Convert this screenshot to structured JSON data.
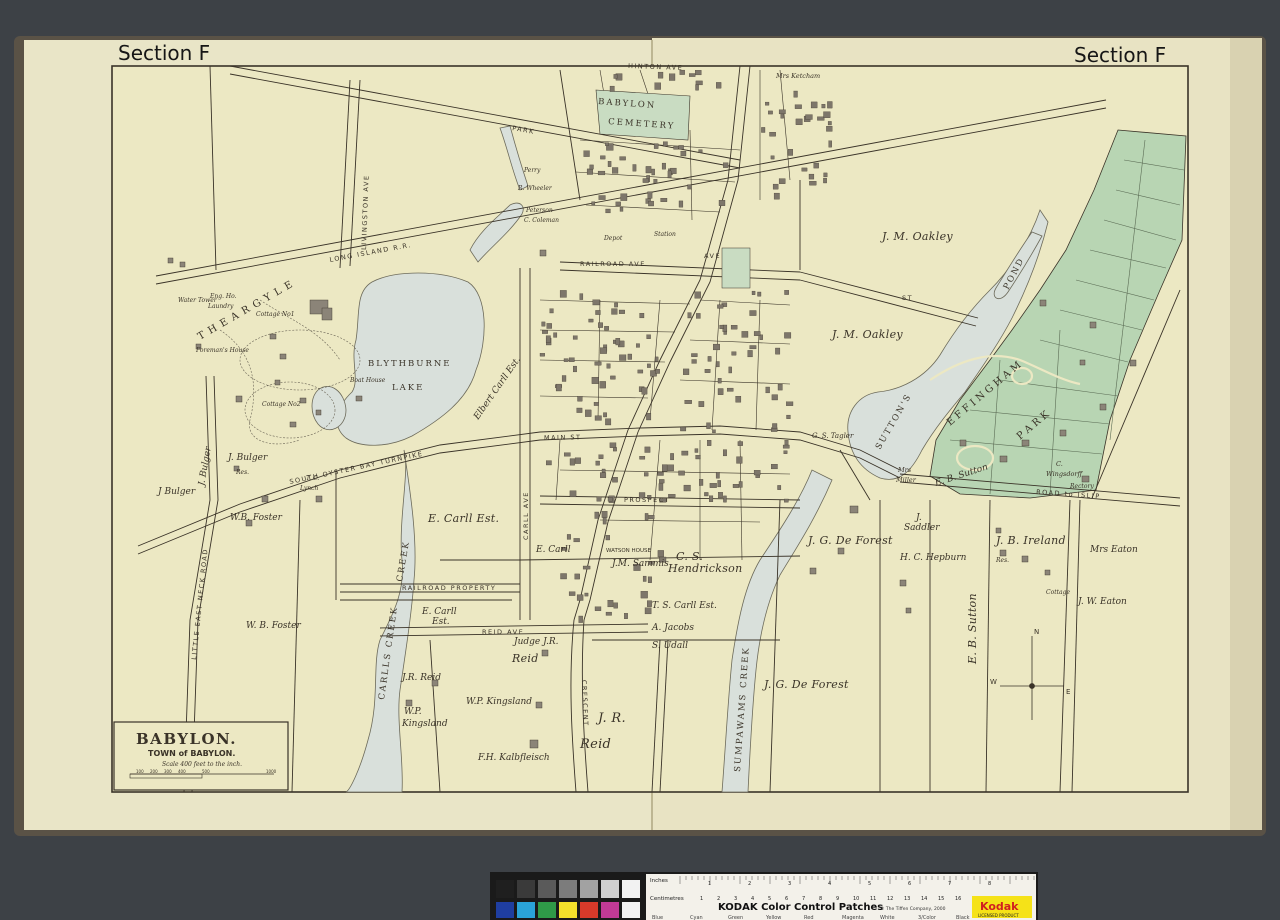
{
  "sheet": {
    "section_left": "Section F",
    "section_right": "Section F"
  },
  "title_box": {
    "title": "BABYLON.",
    "subtitle": "TOWN of BABYLON.",
    "scale": "Scale 400 feet to the inch.",
    "scale_ticks": [
      "100",
      "200",
      "300",
      "400",
      "500",
      "1000"
    ]
  },
  "compass": {
    "n": "N",
    "s": "S",
    "e": "E",
    "w": "W"
  },
  "labels": {
    "section_f": "Section F",
    "the_argyle": "T H E   A R G Y L E",
    "blythburne": "BLYTHBURNE",
    "lake": "LAKE",
    "babylon": "BABYLON",
    "cemetery": "CEMETERY",
    "long_island_rr": "LONG  ISLAND  R.R.",
    "livingston_ave": "LIVINGSTON   AVE",
    "park": "PARK",
    "ave": "AVE",
    "railroad_ave": "RAILROAD   AVE",
    "main_st": "MAIN   ST",
    "south_oyster_bay": "SOUTH  OYSTER  BAY  TURNPIKE",
    "prospect": "PROSPECT",
    "railroad_property": "RAILROAD  PROPERTY",
    "reid_ave": "REID  AVE",
    "carll_ave": "CARLL  AVE",
    "crescent": "CRESCENT",
    "carlls_creek": "CARLLS   CREEK",
    "creek": "CREEK",
    "sumpawams_creek": "SUMPAWAMS  CREEK",
    "suttons_pond": "SUTTON'S",
    "pond": "POND",
    "effingham": "E F F I N G H A M",
    "park_lbl": "P A R K",
    "road_to_islip": "ROAD  to  ISLIP",
    "little_east_neck_road": "LITTLE  EAST  NECK  ROAD",
    "hinton_ave": "HINTON  AVE",
    "st": "ST",
    "jm_oakley_1": "J. M. Oakley",
    "jm_oakley_2": "J. M. Oakley",
    "e_carll_est": "E. Carll  Est.",
    "e_carll_est_2": "E. Carll",
    "e_carll_est_3": "Est.",
    "e_carll": "E. Carll",
    "elbert_carll_est": "Elbert Carll Est.",
    "wb_foster": "W. B. Foster",
    "wb_foster_2": "W.B. Foster",
    "jg_deforest_1": "J. G. De Forest",
    "jg_deforest_2": "J. G. De Forest",
    "jr_reid_1": "J. R.",
    "jr_reid_2": "Reid",
    "judge_reid": "Judge J.R.",
    "reid": "Reid",
    "jr_reid_small": "J.R. Reid",
    "cs_hendrickson_1": "C. S.",
    "cs_hendrickson_2": "Hendrickson",
    "ts_carll_est": "T. S. Carll  Est.",
    "jm_sammis": "J.M. Sammis",
    "watson_house": "WATSON HOUSE",
    "wp_kingsland": "W.P. Kingsland",
    "wp": "W.P.",
    "kingsland": "Kingsland",
    "fh_kalbfleisch": "F.H. Kalbfleisch",
    "a_jacobs": "A. Jacobs",
    "s_udall": "S. Udall",
    "hc_hepburn": "H. C. Hepburn",
    "j_sadleir": "J.",
    "sadleir": "Saddler",
    "eb_sutton": "E. B. Sutton",
    "eb_sutton_2": "E. B. Sutton",
    "jb_ireland": "J. B. Ireland",
    "mrs_eaton": "Mrs Eaton",
    "jw_eaton": "J. W. Eaton",
    "cottage": "Cottage",
    "res": "Res.",
    "j_bulger": "J. Bulger",
    "j_bulger_2": "J. Bulger",
    "j_bulger_3": "J Bulger",
    "j_bulger_res": "Res.",
    "tc_lynch": "T. C.",
    "lynch": "Lynch",
    "g_s_tagler": "G. S. Tagler",
    "mrs_miller": "Mrs",
    "miller": "Miller",
    "c_wingsdorff": "C.",
    "wingsdorff": "Wingsdorff",
    "rectory": "Rectory",
    "mrs_ketcham": "Mrs Ketcham",
    "engine_house": "Eng. Ho.",
    "laundry": "Laundry",
    "water_tower": "Water Tower",
    "foremans_house": "Foreman's House",
    "boat_house": "Boat House",
    "cottage_no1": "Cottage No1",
    "cottage_no2": "Cottage No2",
    "depot": "Depot",
    "r_wheeler": "R. Wheeler",
    "perry": "Perry",
    "c_coleman": "C. Coleman",
    "peterson": "Peterson",
    "mrs_whitman": "Whitman",
    "station": "Station"
  },
  "kodak_card": {
    "inches": "Inches",
    "centimetres": "Centimetres",
    "title": "KODAK Color Control Patches",
    "copyright": "© The Tiffen Company, 2000",
    "brand": "Kodak",
    "licensed": "LICENSED PRODUCT",
    "patch_names": [
      "Blue",
      "Cyan",
      "Green",
      "Yellow",
      "Red",
      "Magenta",
      "White",
      "3/Color",
      "Black"
    ],
    "inch_numbers": [
      "1",
      "2",
      "3",
      "4",
      "5",
      "6",
      "7",
      "8"
    ],
    "cm_numbers": [
      "1",
      "2",
      "3",
      "4",
      "5",
      "6",
      "7",
      "8",
      "9",
      "10",
      "11",
      "12",
      "13",
      "14",
      "15",
      "16",
      "17",
      "18",
      "19"
    ]
  },
  "colors": {
    "paper": "#ece8c3",
    "water": "#d8dfd9",
    "park_green": "#b5d3b0",
    "ink": "#3a3328",
    "background": "#3d4146"
  }
}
